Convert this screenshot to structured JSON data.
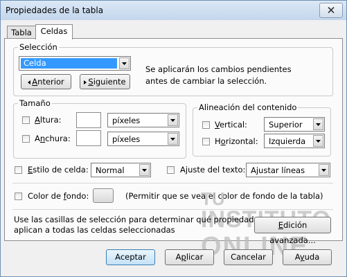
{
  "window": {
    "title": "Propiedades de la tabla"
  },
  "tabs": [
    {
      "label": "Tabla",
      "active": false
    },
    {
      "label": "Celdas",
      "active": true
    }
  ],
  "selection": {
    "legend": "Selección",
    "dropdown_value": "Celda",
    "prev_button": "Anterior",
    "next_button": "Siguiente",
    "info_line1": "Se aplicarán los cambios pendientes",
    "info_line2": "antes de cambiar la selección."
  },
  "size": {
    "legend": "Tamaño",
    "height_label": "Altura:",
    "height_value": "",
    "height_unit": "píxeles",
    "width_label": "Anchura:",
    "width_value": "",
    "width_unit": "píxeles"
  },
  "alignment": {
    "legend": "Alineación del contenido",
    "vertical_label": "Vertical:",
    "vertical_value": "Superior",
    "horizontal_label": "Horizontal:",
    "horizontal_value": "Izquierda"
  },
  "cell_style": {
    "label": "Estilo de celda:",
    "value": "Normal"
  },
  "text_wrap": {
    "label": "Ajuste del texto:",
    "value": "Ajustar líneas"
  },
  "background": {
    "label": "Color de fondo:",
    "note": "(Permitir que se vea el color de fondo de la tabla)"
  },
  "footer_note": {
    "line1": "Use las casillas de selección para determinar qué propiedades se",
    "line2": "aplican a todas las celdas seleccionadas"
  },
  "advanced_button": "Edición avanzada...",
  "dialog_buttons": {
    "accept": "Aceptar",
    "apply": "Aplicar",
    "cancel": "Cancelar",
    "help": "Ayuda"
  },
  "watermark": {
    "line1": "TU",
    "line2": "INSTITUTO",
    "line3": "ONLINE"
  },
  "colors": {
    "selection_highlight": "#3399ff",
    "default_button_border": "#3c7fb1",
    "title_bar": "#c3d6ec",
    "watermark_gray": "#bdbdbd"
  }
}
